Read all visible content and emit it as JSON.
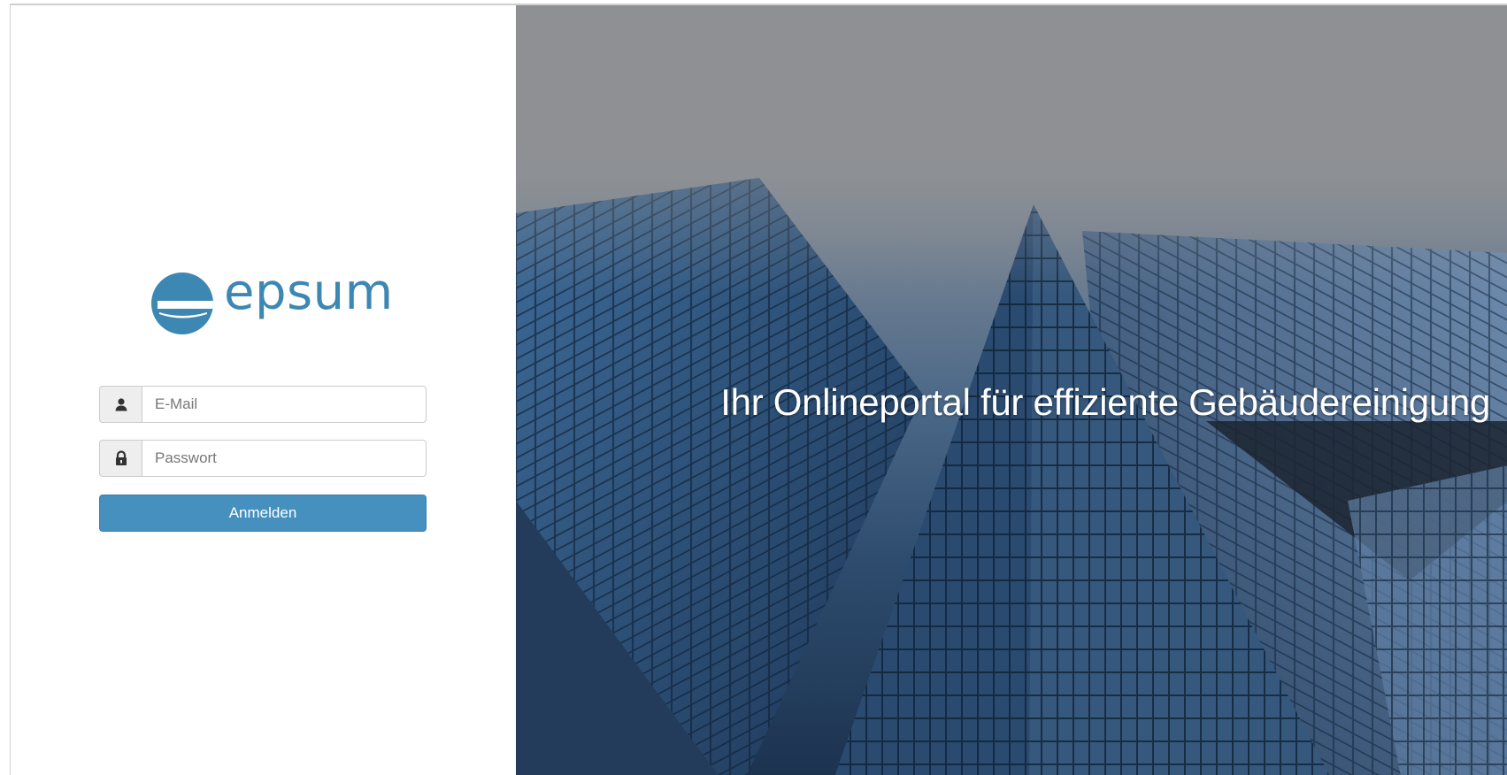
{
  "brand": {
    "logo_text": "epsum",
    "logo_icon": "epsum-e-logo",
    "color": "#3d88b3"
  },
  "login": {
    "email_placeholder": "E-Mail",
    "email_value": "",
    "email_icon": "user-icon",
    "password_placeholder": "Passwort",
    "password_value": "",
    "password_icon": "lock-icon",
    "submit_label": "Anmelden",
    "button_color": "#4590bf"
  },
  "hero": {
    "title": "Ihr Onlineportal für effiziente Gebäudereinigung",
    "image": "glass-skyscrapers-photo"
  }
}
